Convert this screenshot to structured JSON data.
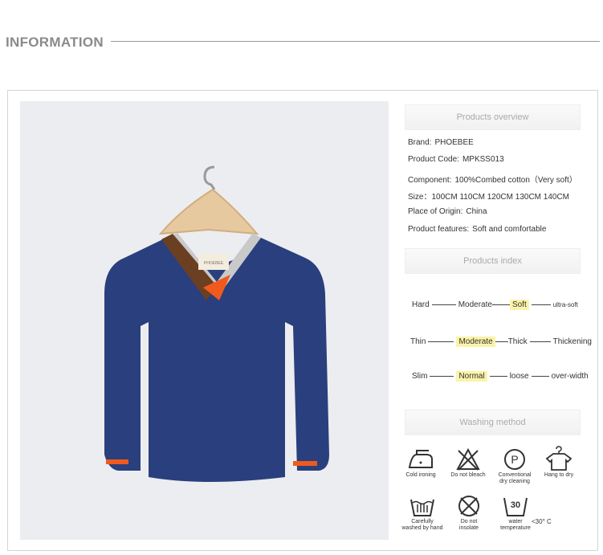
{
  "header": {
    "title": "INFORMATION"
  },
  "product_image": {
    "label_text": "PHOEBEE"
  },
  "overview": {
    "title": "Products overview",
    "rows": [
      {
        "label": "Brand:",
        "value": "PHOEBEE"
      },
      {
        "label": "Product Code:",
        "value": "MPKSS013"
      },
      {
        "label": "Component:",
        "value": "100%Combed cotton（Very soft）"
      },
      {
        "label": "Size：",
        "value": "100CM  110CM  120CM  130CM  140CM"
      },
      {
        "label": "Place of Origin:",
        "value": "China"
      },
      {
        "label": "Product features:",
        "value": "Soft and comfortable"
      }
    ]
  },
  "index": {
    "title": "Products index",
    "softness": {
      "a": "Hard",
      "b": "Moderate",
      "c": "Soft",
      "d": "ultra-soft",
      "selected": "Soft"
    },
    "thickness": {
      "a": "Thin",
      "b": "Moderate",
      "c": "Thick",
      "d": "Thickening",
      "selected": "Moderate"
    },
    "fit": {
      "a": "Slim",
      "b": "Normal",
      "c": "loose",
      "d": "over-width",
      "selected": "Normal"
    }
  },
  "washing": {
    "title": "Washing method",
    "items": [
      {
        "icon": "iron-icon",
        "line1": "Cold ironing",
        "line2": ""
      },
      {
        "icon": "no-bleach-icon",
        "line1": "Do not bleach",
        "line2": ""
      },
      {
        "icon": "dry-clean-icon",
        "line1": "Conventional",
        "line2": "dry cleaning",
        "symbol": "P"
      },
      {
        "icon": "hang-dry-icon",
        "line1": "Hang to dry",
        "line2": ""
      },
      {
        "icon": "hand-wash-icon",
        "line1": "Carefully",
        "line2": "washed by hand"
      },
      {
        "icon": "no-insolate-icon",
        "line1": "Do not",
        "line2": "insolate"
      },
      {
        "icon": "water-temp-icon",
        "line1": "water",
        "line2": "temperature",
        "symbol": "30"
      }
    ],
    "temp_note": "<30° C"
  },
  "colors": {
    "sweater": "#2a3f7d",
    "accent_orange": "#f05a1c",
    "accent_brown": "#6b3f22",
    "collar_gray": "#c9c9c9",
    "highlight": "#fbf3a9"
  }
}
